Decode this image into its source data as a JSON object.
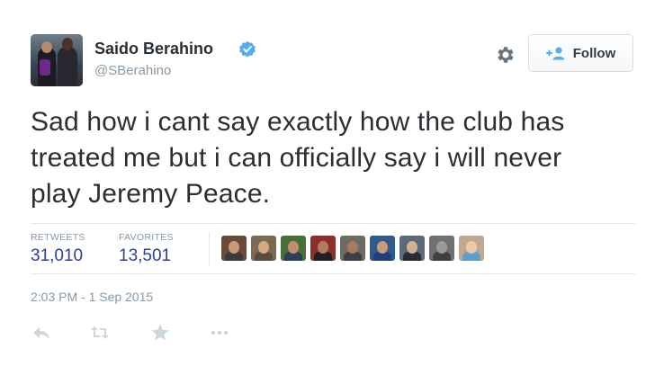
{
  "user": {
    "name": "Saido Berahino",
    "handle": "@SBerahino",
    "verified": true
  },
  "follow_button": {
    "label": "Follow"
  },
  "tweet": {
    "lines": [
      "Sad how i cant say exactly how the club has",
      "treated me but i can officially say i will never",
      "play Jeremy Peace."
    ]
  },
  "stats": {
    "retweets_label": "RETWEETS",
    "retweets_value": "31,010",
    "favorites_label": "FAVORITES",
    "favorites_value": "13,501"
  },
  "favoriter_avatars": [
    {
      "bg": "#6a4a3a",
      "skin": "#c8987a",
      "shirt": "#3c3a3a"
    },
    {
      "bg": "#7b6a55",
      "skin": "#d6a983",
      "shirt": "#5d4b3e"
    },
    {
      "bg": "#4a6f3a",
      "skin": "#c28e6d",
      "shirt": "#2e3f5a"
    },
    {
      "bg": "#8a2e2e",
      "skin": "#b57b5e",
      "shirt": "#1f1f2a"
    },
    {
      "bg": "#6e6a64",
      "skin": "#a87a5e",
      "shirt": "#3a3f48"
    },
    {
      "bg": "#2f5a8a",
      "skin": "#c79a7a",
      "shirt": "#1d3f7a"
    },
    {
      "bg": "#5a6a78",
      "skin": "#d3b094",
      "shirt": "#2b2b35"
    },
    {
      "bg": "#707070",
      "skin": "#9a9a9a",
      "shirt": "#404040"
    },
    {
      "bg": "#c0a890",
      "skin": "#f0c9a8",
      "shirt": "#5aa0c8"
    }
  ],
  "timestamp": "2:03 PM - 1 Sep 2015",
  "colors": {
    "link_blue": "#2b3f9c",
    "verified_blue": "#55acee",
    "muted": "#8899a6"
  },
  "icons": [
    "verified-badge-icon",
    "gear-icon",
    "follow-person-icon",
    "reply-icon",
    "retweet-icon",
    "favorite-star-icon",
    "more-dots-icon"
  ]
}
